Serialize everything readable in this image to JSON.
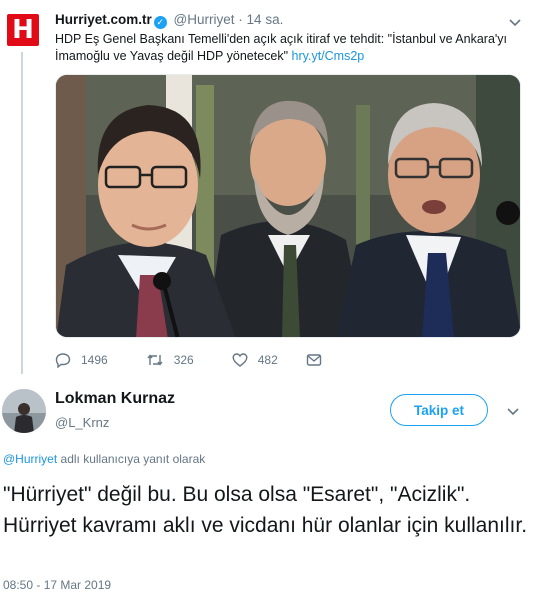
{
  "parent_tweet": {
    "account_name": "Hurriyet.com.tr",
    "handle": "@Hurriyet",
    "separator": "·",
    "time": "14 sa.",
    "logo_letter": "H",
    "text": "HDP Eş Genel Başkanı Temelli'den açık açık itiraf ve tehdit: \"İstanbul ve Ankara'yı İmamoğlu ve Yavaş değil HDP yönetecek\"",
    "link": "hry.yt/Cms2p",
    "actions": {
      "replies": "1496",
      "retweets": "326",
      "likes": "482"
    },
    "icons": {
      "verified": "verified-badge-icon",
      "more": "chevron-down-icon",
      "reply": "reply-icon",
      "retweet": "retweet-icon",
      "like": "heart-icon",
      "dm": "mail-icon"
    }
  },
  "main_tweet": {
    "display_name": "Lokman Kurnaz",
    "handle": "@L_Krnz",
    "follow_label": "Takip et",
    "reply_context_mention": "@Hurriyet",
    "reply_context_rest": " adlı kullanıcıya yanıt olarak",
    "text": "\"Hürriyet\" değil bu. Bu olsa olsa \"Esaret\", \"Acizlik\". Hürriyet kavramı aklı ve vicdanı hür olanlar için kullanılır.",
    "timestamp": "08:50 - 17 Mar 2019"
  },
  "colors": {
    "accent": "#1da1f2",
    "link": "#1b95e0",
    "muted": "#657786",
    "brand_red": "#e10b17"
  }
}
